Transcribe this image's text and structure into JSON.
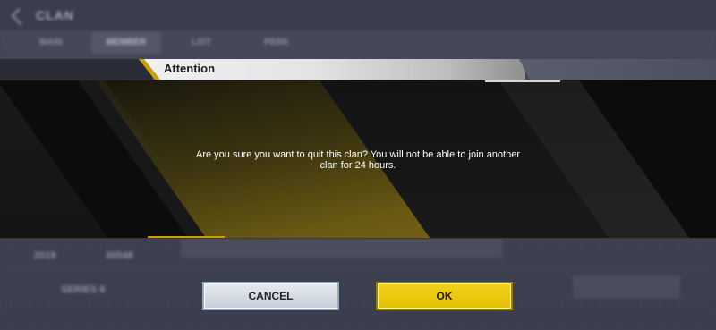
{
  "background": {
    "screen_title": "CLAN",
    "tabs": [
      "MAIN",
      "MEMBER",
      "LIST",
      "PERK"
    ],
    "active_tab_index": 1,
    "stat_left": "2019",
    "stat_right": "30548",
    "series_label": "SERIES 8"
  },
  "dialog": {
    "title": "Attention",
    "message_line1": "Are you sure you want to quit this clan? You will not be able to join another",
    "message_line2": "clan for 24 hours.",
    "cancel_label": "CANCEL",
    "ok_label": "OK"
  },
  "colors": {
    "accent": "#c9a200",
    "ok_button": "#e5c000",
    "cancel_button": "#d5dbe3"
  }
}
